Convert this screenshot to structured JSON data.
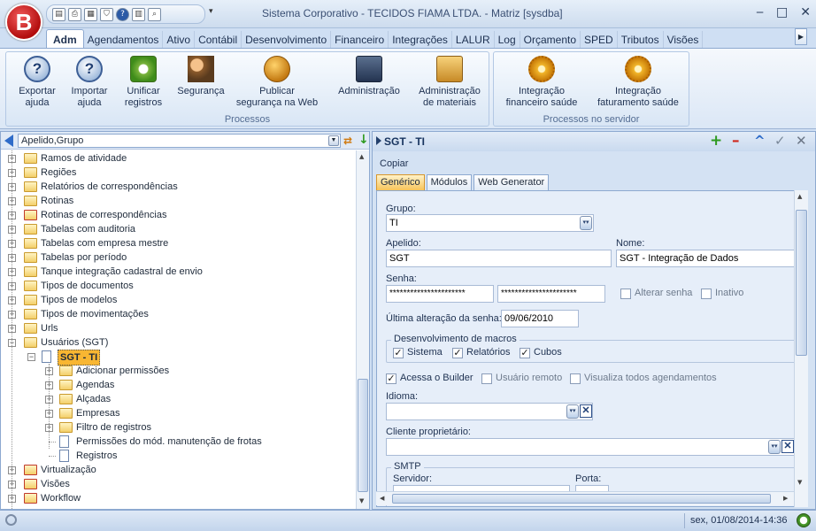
{
  "window": {
    "logo_letter": "B",
    "title": "Sistema Corporativo - TECIDOS FIAMA LTDA. - Matriz [sysdba]",
    "controls": {
      "minimize": "‒",
      "maximize": "□",
      "close": "✕"
    }
  },
  "ribbon_tabs": [
    "Adm",
    "Agendamentos",
    "Ativo",
    "Contábil",
    "Desenvolvimento",
    "Financeiro",
    "Integrações",
    "LALUR",
    "Log",
    "Orçamento",
    "SPED",
    "Tributos",
    "Visões"
  ],
  "ribbon": {
    "groups": [
      {
        "label": "Processos",
        "buttons": [
          {
            "label_1": "Exportar",
            "label_2": "ajuda",
            "icon": "help-export-icon"
          },
          {
            "label_1": "Importar",
            "label_2": "ajuda",
            "icon": "help-import-icon"
          },
          {
            "label_1": "Unificar",
            "label_2": "registros",
            "icon": "sync-icon"
          },
          {
            "label_1": "Segurança",
            "label_2": "",
            "icon": "users-icon"
          },
          {
            "label_1": "Publicar",
            "label_2": "segurança na Web",
            "icon": "globe-icon"
          },
          {
            "label_1": "Administração",
            "label_2": "",
            "icon": "computer-icon"
          },
          {
            "label_1": "Administração",
            "label_2": "de materiais",
            "icon": "box-icon"
          }
        ]
      },
      {
        "label": "Processos no servidor",
        "buttons": [
          {
            "label_1": "Integração",
            "label_2": "financeiro saúde",
            "icon": "gear-icon"
          },
          {
            "label_1": "Integração",
            "label_2": "faturamento saúde",
            "icon": "gear-icon"
          }
        ]
      }
    ]
  },
  "left_panel": {
    "sort_combo": "Apelido,Grupo",
    "tree": [
      {
        "label": "Ramos de atividade",
        "level": 0
      },
      {
        "label": "Regiões",
        "level": 0
      },
      {
        "label": "Relatórios de correspondências",
        "level": 0
      },
      {
        "label": "Rotinas",
        "level": 0
      },
      {
        "label": "Rotinas de correspondências",
        "level": 0
      },
      {
        "label": "Tabelas com auditoria",
        "level": 0
      },
      {
        "label": "Tabelas com empresa mestre",
        "level": 0
      },
      {
        "label": "Tabelas por período",
        "level": 0
      },
      {
        "label": "Tanque integração cadastral de envio",
        "level": 0
      },
      {
        "label": "Tipos de documentos",
        "level": 0
      },
      {
        "label": "Tipos de modelos",
        "level": 0
      },
      {
        "label": "Tipos de movimentações",
        "level": 0
      },
      {
        "label": "Urls",
        "level": 0
      },
      {
        "label": "Usuários (SGT)",
        "level": 0
      },
      {
        "label": "SGT - TI",
        "level": 1
      },
      {
        "label": "Adicionar permissões",
        "level": 2
      },
      {
        "label": "Agendas",
        "level": 2
      },
      {
        "label": "Alçadas",
        "level": 2
      },
      {
        "label": "Empresas",
        "level": 2
      },
      {
        "label": "Filtro de registros",
        "level": 2
      },
      {
        "label": "Permissões do mód. manutenção de frotas",
        "level": 2
      },
      {
        "label": "Registros",
        "level": 2
      },
      {
        "label": "Virtualização",
        "level": 0
      },
      {
        "label": "Visões",
        "level": 0
      },
      {
        "label": "Workflow",
        "level": 0
      }
    ]
  },
  "right_panel": {
    "title": "SGT - TI",
    "actions": {
      "add": "+",
      "delete": "–",
      "up": "^",
      "confirm": "✓",
      "cancel": "✕"
    },
    "copiar": "Copiar",
    "tabs": [
      "Genérico",
      "Módulos",
      "Web Generator"
    ],
    "form": {
      "grupo_label": "Grupo:",
      "grupo_value": "TI",
      "apelido_label": "Apelido:",
      "apelido_value": "SGT",
      "nome_label": "Nome:",
      "nome_value": "SGT  -  Integração de Dados",
      "senha_label": "Senha:",
      "senha_value": "**********************",
      "senha_confirm_value": "**********************",
      "alterar_senha": "Alterar senha",
      "inativo": "Inativo",
      "ultima_alteracao_label": "Última alteração da senha:",
      "ultima_alteracao_value": "09/06/2010",
      "macros_legend": "Desenvolvimento de macros",
      "macro_sistema": "Sistema",
      "macro_relatorios": "Relatórios",
      "macro_cubos": "Cubos",
      "acessa_builder": "Acessa o Builder",
      "usuario_remoto": "Usuário remoto",
      "visualiza_agendamentos": "Visualiza todos agendamentos",
      "idioma_label": "Idioma:",
      "idioma_value": "",
      "cliente_label": "Cliente proprietário:",
      "cliente_value": "",
      "smtp_legend": "SMTP",
      "servidor_label": "Servidor:",
      "porta_label": "Porta:"
    }
  },
  "status_bar": {
    "datetime": "sex, 01/08/2014-14:36"
  },
  "colors": {
    "accent_orange": "#f8b632",
    "add_green": "#2e9a1f",
    "delete_red": "#d0281e",
    "frame_blue": "#8da9d0"
  }
}
